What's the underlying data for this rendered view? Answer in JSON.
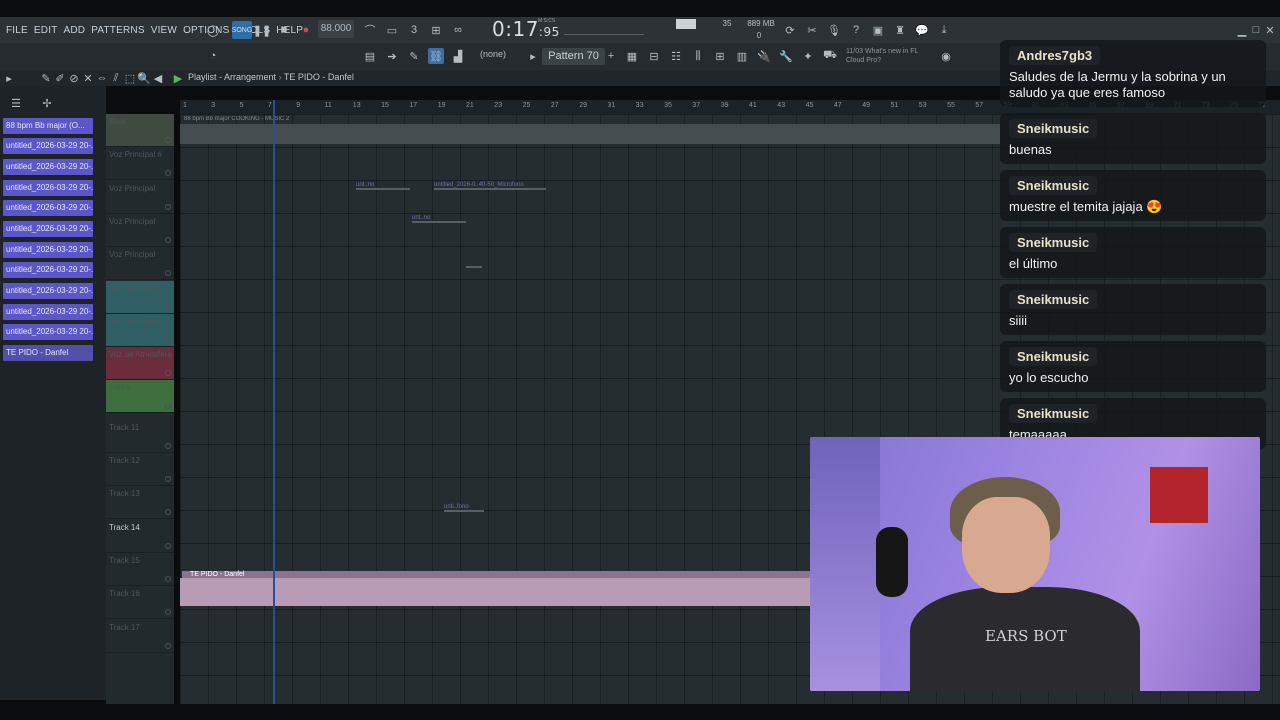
{
  "menu": [
    "FILE",
    "EDIT",
    "ADD",
    "PATTERNS",
    "VIEW",
    "OPTIONS",
    "TOOLS",
    "HELP"
  ],
  "transport": {
    "tempo": "88.000",
    "time": "0:17",
    "time_fraction": ":95",
    "time_label": "M:S:CS",
    "memory": "889 MB",
    "cpu": "35",
    "zero": "0"
  },
  "pattern": {
    "label": "Pattern 70",
    "none": "(none)"
  },
  "hint": {
    "date": "11/03",
    "text": "What's new in FL Cloud Pro?"
  },
  "playlist": {
    "title": "Playlist - Arrangement",
    "crumb": "TE PIDO - Danfel"
  },
  "ruler_ticks": [
    "1",
    "3",
    "5",
    "7",
    "9",
    "11",
    "13",
    "15",
    "17",
    "19",
    "21",
    "23",
    "25",
    "27",
    "29",
    "31",
    "33",
    "35",
    "37",
    "39",
    "41",
    "43",
    "45",
    "47",
    "49",
    "51",
    "53",
    "55",
    "57",
    "59",
    "61",
    "63",
    "65",
    "67",
    "69",
    "71",
    "73",
    "75",
    "77"
  ],
  "clips": [
    "88 bpm Bb major (O...",
    "untitled_2026-03-29 20-...",
    "untitled_2026-03-29 20-...",
    "untitled_2026-03-29 20-...",
    "untitled_2026-03-29 20-...",
    "untitled_2026-03-29 20-...",
    "untitled_2026-03-29 20-...",
    "untitled_2026-03-29 20-...",
    "untitled_2026-03-29 20-...",
    "untitled_2026-03-29 20-...",
    "untitled_2026-03-29 20-...",
    "TE PIDO - Danfel"
  ],
  "tracks": [
    "Beat",
    "Voz Principal #",
    "Voz Principal",
    "Voz Principal",
    "Voz Principal",
    "Voz de Apoyo",
    "Voz de Apoyo",
    "Voz de Atmosfera",
    "Adlibs",
    "Track 11",
    "Track 12",
    "Track 13",
    "Track 14",
    "Track 15",
    "Track 16",
    "Track 17"
  ],
  "grid_clips": {
    "beat_clip": "88 bpm Bb major COOKING - MUSIC 2",
    "te_pido_clip": "TE PIDO - Danfel",
    "mini1": "unt..no",
    "mini2": "untitled_2026-0..40-50_Microfono",
    "mini3": "unt..no",
    "mini4": "unti..fono"
  },
  "chat": [
    {
      "user": "Andres7gb3",
      "text": "Saludes de la Jermu y la sobrina y un saludo ya que eres famoso"
    },
    {
      "user": "Sneikmusic",
      "text": "buenas"
    },
    {
      "user": "Sneikmusic",
      "text": "muestre el temita jajaja 😍"
    },
    {
      "user": "Sneikmusic",
      "text": "el último"
    },
    {
      "user": "Sneikmusic",
      "text": "siiii"
    },
    {
      "user": "Sneikmusic",
      "text": "yo lo escucho"
    },
    {
      "user": "Sneikmusic",
      "text": "temaaaaa"
    }
  ],
  "webcam": {
    "shirt_text": "EARS BOT"
  }
}
